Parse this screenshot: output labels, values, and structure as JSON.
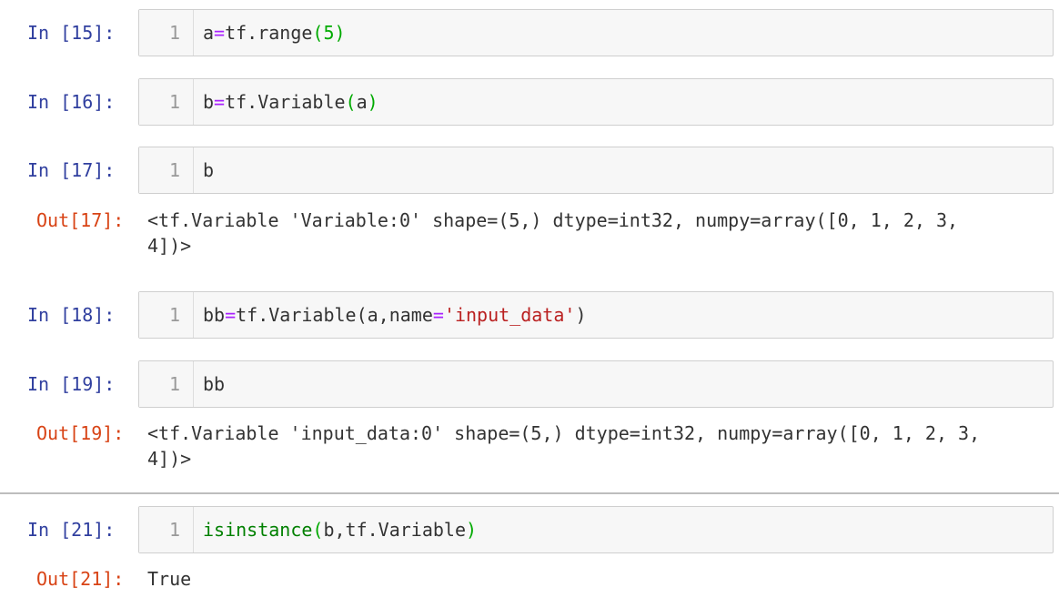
{
  "cells": [
    {
      "in_prompt": "In  [15]:",
      "line_no": "1",
      "code": {
        "p1": "a",
        "p2": "=",
        "p3": "tf.range",
        "p4": "(",
        "p5": "5",
        "p6": ")"
      }
    },
    {
      "in_prompt": "In  [16]:",
      "line_no": "1",
      "code": {
        "p1": "b",
        "p2": "=",
        "p3": "tf.Variable",
        "p4": "(",
        "p5": "a",
        "p6": ")"
      }
    },
    {
      "in_prompt": "In  [17]:",
      "line_no": "1",
      "code": {
        "p1": "b"
      },
      "out_prompt": "Out[17]:",
      "output": "<tf.Variable 'Variable:0' shape=(5,) dtype=int32, numpy=array([0, 1, 2, 3,\n4])>"
    },
    {
      "in_prompt": "In  [18]:",
      "line_no": "1",
      "code": {
        "p1": "bb",
        "p2": "=",
        "p3": "tf.Variable(a,name",
        "p4": "=",
        "p5": "'input_data'",
        "p6": ")"
      }
    },
    {
      "in_prompt": "In  [19]:",
      "line_no": "1",
      "code": {
        "p1": "bb"
      },
      "out_prompt": "Out[19]:",
      "output": "<tf.Variable 'input_data:0' shape=(5,) dtype=int32, numpy=array([0, 1, 2, 3,\n4])>"
    },
    {
      "in_prompt": "In  [21]:",
      "line_no": "1",
      "code": {
        "p1": "isinstance",
        "p2": "(",
        "p3": "b,tf.Variable",
        "p4": ")"
      },
      "out_prompt": "Out[21]:",
      "output": "True"
    }
  ]
}
